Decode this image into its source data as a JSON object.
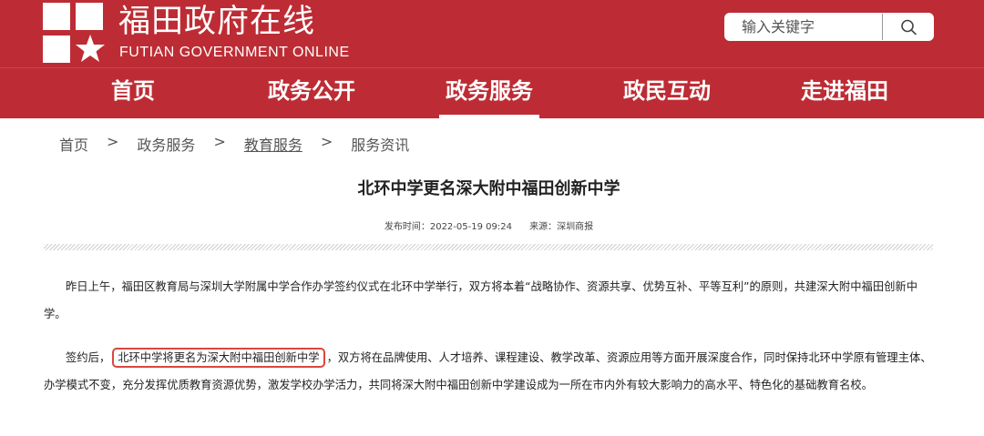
{
  "header": {
    "site_title": "福田政府在线",
    "site_subtitle": "FUTIAN GOVERNMENT ONLINE",
    "brand_color": "#bd2c34"
  },
  "search": {
    "placeholder": "输入关键字",
    "icon": "search-icon"
  },
  "nav": {
    "items": [
      {
        "label": "首页"
      },
      {
        "label": "政务公开"
      },
      {
        "label": "政务服务",
        "active": true
      },
      {
        "label": "政民互动"
      },
      {
        "label": "走进福田"
      }
    ]
  },
  "breadcrumb": {
    "items": [
      "首页",
      "政务服务",
      "教育服务",
      "服务资讯"
    ],
    "separator": ">"
  },
  "article": {
    "title": "北环中学更名深大附中福田创新中学",
    "publish_time": "发布时间：2022-05-19 09:24",
    "source": "来源：深圳商报",
    "p1": "昨日上午，福田区教育局与深圳大学附属中学合作办学签约仪式在北环中学举行，双方将本着“战略协作、资源共享、优势互补、平等互利”的原则，共建深大附中福田创新中学。",
    "p2_before": "签约后，",
    "p2_highlight": "北环中学将更名为深大附中福田创新中学",
    "p2_after": "，双方将在品牌使用、人才培养、课程建设、教学改革、资源应用等方面开展深度合作，同时保持北环中学原有管理主体、办学模式不变，充分发挥优质教育资源优势，激发学校办学活力，共同将深大附中福田创新中学建设成为一所在市内外有较大影响力的高水平、特色化的基础教育名校。",
    "highlight_color": "#d9473f"
  }
}
